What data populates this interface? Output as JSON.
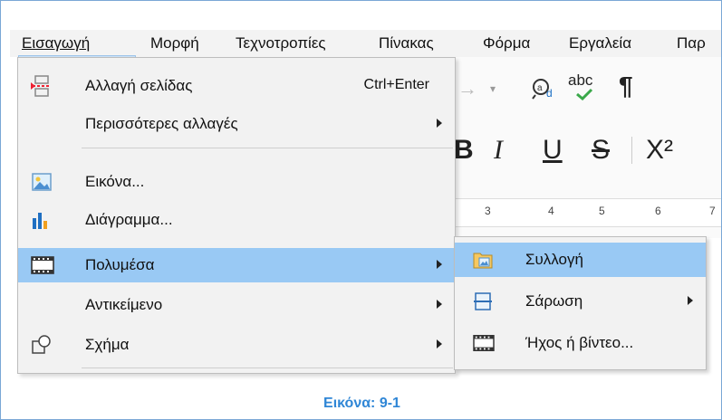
{
  "menubar": {
    "items": [
      "Εισαγωγή",
      "Μορφή",
      "Τεχνοτροπίες",
      "Πίνακας",
      "Φόρμα",
      "Εργαλεία",
      "Παρ"
    ]
  },
  "menu": {
    "items": [
      {
        "label": "Αλλαγή σελίδας",
        "shortcut": "Ctrl+Enter",
        "icon": "page-break-icon"
      },
      {
        "label": "Περισσότερες αλλαγές",
        "submenu": true
      },
      {
        "label": "Εικόνα...",
        "icon": "image-icon"
      },
      {
        "label": "Διάγραμμα...",
        "icon": "chart-icon"
      },
      {
        "label": "Πολυμέσα",
        "submenu": true,
        "icon": "film-icon",
        "highlighted": true
      },
      {
        "label": "Αντικείμενο",
        "submenu": true
      },
      {
        "label": "Σχήμα",
        "submenu": true,
        "icon": "shape-icon"
      }
    ]
  },
  "submenu": {
    "items": [
      {
        "label": "Συλλογή",
        "icon": "gallery-icon",
        "highlighted": true
      },
      {
        "label": "Σάρωση",
        "submenu": true,
        "icon": "scan-icon"
      },
      {
        "label": "Ήχος ή βίντεο...",
        "icon": "film-icon"
      }
    ]
  },
  "toolbar": {
    "abc": "abc",
    "pilcrow": "¶",
    "bold": "B",
    "italic": "I",
    "underline": "U",
    "strike": "S",
    "superscript": "X²",
    "ruler_ticks": [
      "3",
      "4",
      "5",
      "6",
      "7"
    ]
  },
  "caption": "Εικόνα: 9-1"
}
